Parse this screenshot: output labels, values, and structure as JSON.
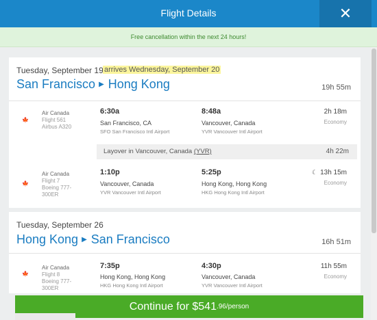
{
  "header": {
    "title": "Flight Details",
    "close_icon": "close-icon"
  },
  "banner": {
    "text": "Free cancellation within the next 24 hours!"
  },
  "outbound": {
    "date": "Tuesday, September 19",
    "arrives": "arrives Wednesday, September 20",
    "from": "San Francisco",
    "to": "Hong Kong",
    "total_duration": "19h 55m",
    "segments": [
      {
        "airline": "Air Canada",
        "flight": "Flight 561",
        "aircraft": "Airbus A320",
        "dep_time": "6:30a",
        "dep_city": "San Francisco, CA",
        "dep_airport": "SFO San Francisco Intl Airport",
        "arr_time": "8:48a",
        "arr_city": "Vancouver, Canada",
        "arr_airport": "YVR Vancouver Intl Airport",
        "duration": "2h 18m",
        "cabin": "Economy"
      },
      {
        "airline": "Air Canada",
        "flight": "Flight 7",
        "aircraft": "Boeing 777-300ER",
        "dep_time": "1:10p",
        "dep_city": "Vancouver, Canada",
        "dep_airport": "YVR Vancouver Intl Airport",
        "arr_time": "5:25p",
        "arr_city": "Hong Kong, Hong Kong",
        "arr_airport": "HKG Hong Kong Intl Airport",
        "duration": "13h 15m",
        "cabin": "Economy"
      }
    ],
    "layover": {
      "text": "Layover in Vancouver, Canada",
      "code": "(YVR)",
      "duration": "4h 22m"
    }
  },
  "return": {
    "date": "Tuesday, September 26",
    "from": "Hong Kong",
    "to": "San Francisco",
    "total_duration": "16h 51m",
    "segments": [
      {
        "airline": "Air Canada",
        "flight": "Flight 8",
        "aircraft": "Boeing 777-300ER",
        "dep_time": "7:35p",
        "dep_city": "Hong Kong, Hong Kong",
        "dep_airport": "HKG Hong Kong Intl Airport",
        "arr_time": "4:30p",
        "arr_city": "Vancouver, Canada",
        "arr_airport": "YVR Vancouver Intl Airport",
        "duration": "11h 55m",
        "cabin": "Economy"
      }
    ]
  },
  "cta": {
    "label": "Continue for $541",
    "cents": ".96/person"
  },
  "colors": {
    "header": "#1b87c9",
    "route": "#1a7cc1",
    "cta": "#4aab27",
    "banner": "#dff3dc",
    "highlight": "#fbf59c"
  }
}
